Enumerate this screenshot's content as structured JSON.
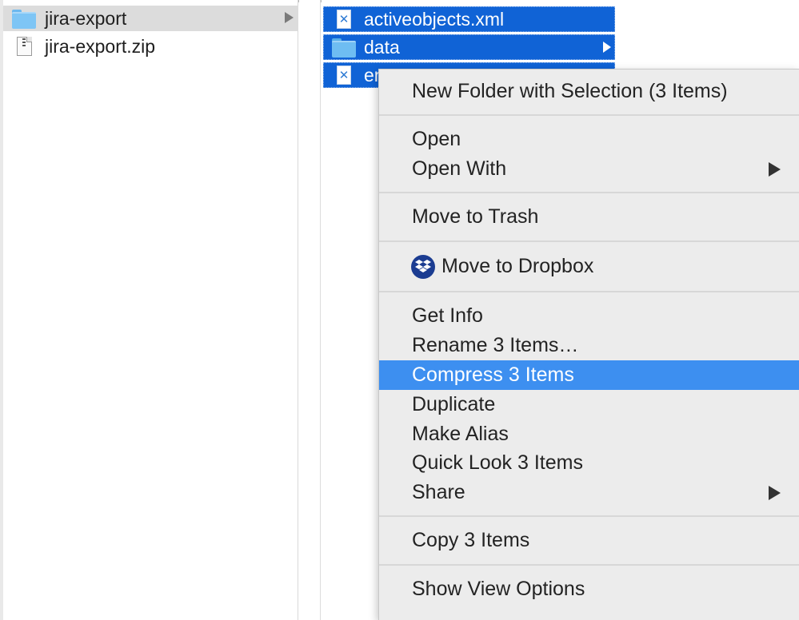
{
  "finder": {
    "column1": {
      "items": [
        {
          "name": "jira-export",
          "icon": "folder-icon",
          "has_children": true,
          "selected": true
        },
        {
          "name": "jira-export.zip",
          "icon": "zip-icon",
          "has_children": false,
          "selected": false
        }
      ]
    },
    "column3": {
      "items": [
        {
          "name": "activeobjects.xml",
          "icon": "xml-file-icon",
          "has_children": false
        },
        {
          "name": "data",
          "icon": "folder-icon",
          "has_children": true
        },
        {
          "name": "entities.xml",
          "visible_text": "en",
          "icon": "xml-file-icon",
          "has_children": false
        }
      ]
    }
  },
  "context_menu": {
    "new_folder": "New Folder with Selection (3 Items)",
    "open": "Open",
    "open_with": "Open With",
    "move_to_trash": "Move to Trash",
    "move_to_dropbox": "Move to Dropbox",
    "get_info": "Get Info",
    "rename": "Rename 3 Items…",
    "compress": "Compress 3 Items",
    "duplicate": "Duplicate",
    "make_alias": "Make Alias",
    "quick_look": "Quick Look 3 Items",
    "share": "Share",
    "copy": "Copy 3 Items",
    "show_view_options": "Show View Options",
    "highlighted_item": "compress"
  },
  "colors": {
    "selection_blue": "#1063d6",
    "menu_highlight": "#3d8ff0",
    "dropbox_blue": "#1b3c91",
    "menu_background": "#ececec"
  }
}
